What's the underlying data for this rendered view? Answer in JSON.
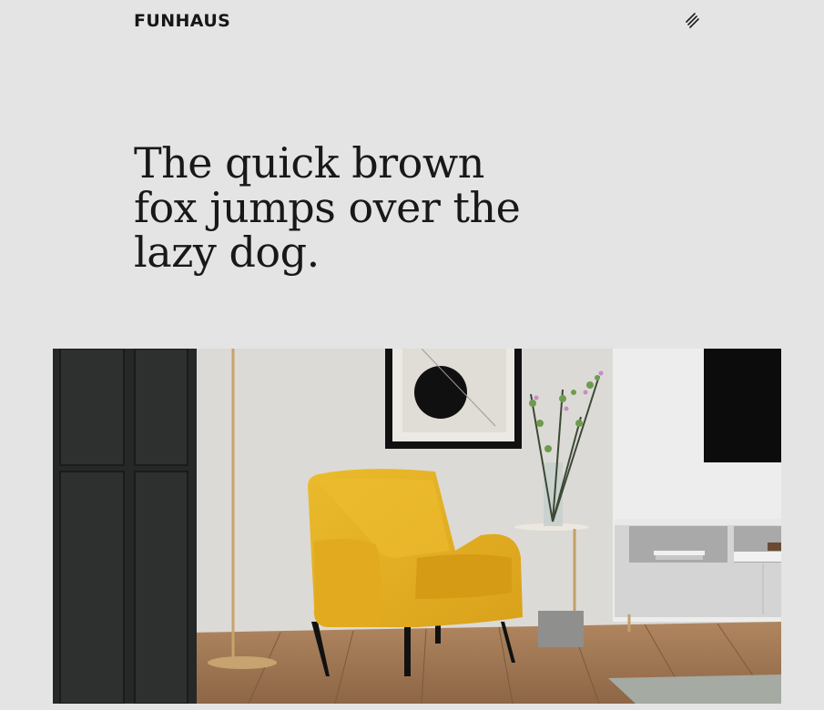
{
  "header": {
    "brand": "FUNHAUS",
    "menu_icon": "menu-slashes-icon"
  },
  "hero": {
    "headline": "The quick brown fox jumps over the lazy dog."
  },
  "colors": {
    "background": "#e4e4e4",
    "text": "#181818",
    "armchair": "#e3b024"
  }
}
